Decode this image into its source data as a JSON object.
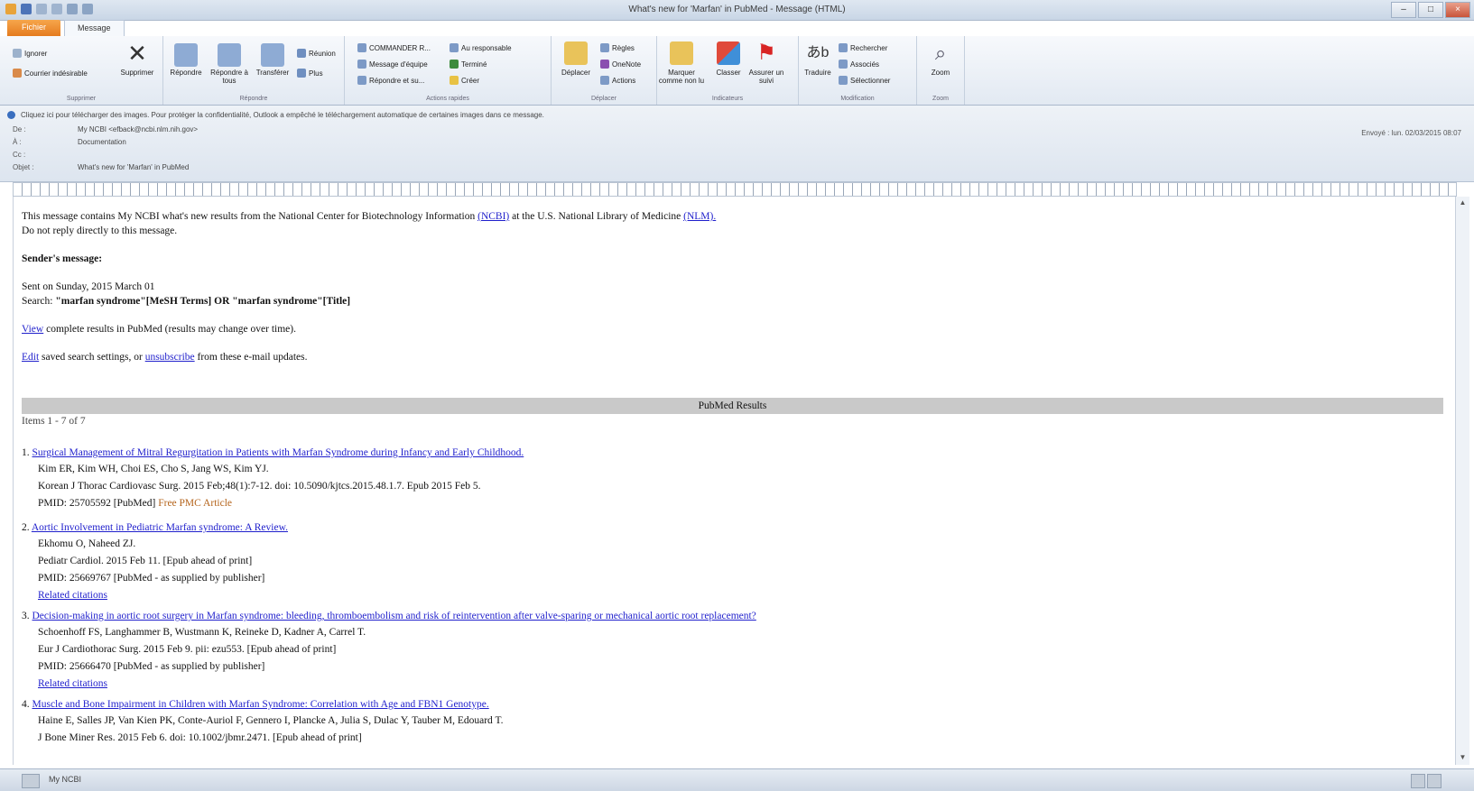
{
  "window": {
    "title": "What's new for 'Marfan' in PubMed - Message (HTML)"
  },
  "tabs": {
    "file": "Fichier",
    "message": "Message"
  },
  "ribbon": {
    "ignore": "Ignorer",
    "junk": "Courrier indésirable",
    "delete": "Supprimer",
    "reply": "Répondre",
    "reply_all": "Répondre à tous",
    "forward": "Transférer",
    "meeting": "Réunion",
    "more": "Plus",
    "qs1": "COMMANDER R...",
    "qs2": "Message d'équipe",
    "qs3": "Répondre et su...",
    "qs4": "Au responsable",
    "qs5": "Terminé",
    "qs6": "Créer",
    "move": "Déplacer",
    "rules": "Règles",
    "onenote": "OneNote",
    "actions": "Actions",
    "mark_unread": "Marquer comme non lu",
    "categorize": "Classer",
    "followup": "Assurer un suivi",
    "translate": "Traduire",
    "find": "Rechercher",
    "related": "Associés",
    "select": "Sélectionner",
    "zoom": "Zoom",
    "group_delete": "Supprimer",
    "group_respond": "Répondre",
    "group_quicksteps": "Actions rapides",
    "group_move": "Déplacer",
    "group_tags": "Indicateurs",
    "group_editing": "Modification",
    "group_zoom": "Zoom"
  },
  "header": {
    "infobar": "Cliquez ici pour télécharger des images. Pour protéger la confidentialité, Outlook a empêché le téléchargement automatique de certaines images dans ce message.",
    "from_label": "De :",
    "from_value": "My NCBI <efback@ncbi.nlm.nih.gov>",
    "to_label": "À :",
    "to_value": "Documentation",
    "cc_label": "Cc :",
    "subject_label": "Objet :",
    "subject_value": "What's new for 'Marfan' in PubMed",
    "sent_label": "Envoyé :",
    "sent_value": "lun. 02/03/2015 08:07"
  },
  "body": {
    "intro_a": "This message contains My NCBI what's new results from the National Center for Biotechnology Information",
    "ncbi": "(NCBI)",
    "intro_b": "at the U.S. National Library of Medicine",
    "nlm": "(NLM).",
    "noreply": "Do not reply directly to this message.",
    "sender_msg": "Sender's message:",
    "sent_on": "Sent on Sunday, 2015 March 01",
    "search_label": "Search:",
    "search_query": "\"marfan syndrome\"[MeSH Terms] OR \"marfan syndrome\"[Title]",
    "view_link": "View",
    "view_rest": "complete results in PubMed (results may change over time).",
    "edit_link": "Edit",
    "edit_mid": "saved search settings, or",
    "unsub_link": "unsubscribe",
    "edit_rest": "from these e-mail updates.",
    "pm_title": "PubMed Results",
    "items_count": "Items 1 - 7 of 7"
  },
  "results": [
    {
      "num": "1.",
      "title": "Surgical Management of Mitral Regurgitation in Patients with Marfan Syndrome during Infancy and Early Childhood.",
      "authors": "Kim ER, Kim WH, Choi ES, Cho S, Jang WS, Kim YJ.",
      "journal": "Korean J Thorac Cardiovasc Surg. 2015 Feb;48(1):7-12. doi: 10.5090/kjtcs.2015.48.1.7. Epub 2015 Feb 5.",
      "pmid": "PMID: 25705592 [PubMed]",
      "extra": "Free PMC Article"
    },
    {
      "num": "2.",
      "title": "Aortic Involvement in Pediatric Marfan syndrome: A Review.",
      "authors": "Ekhomu O, Naheed ZJ.",
      "journal": "Pediatr Cardiol. 2015 Feb 11. [Epub ahead of print]",
      "pmid": "PMID: 25669767 [PubMed - as supplied by publisher]",
      "extra": "Related citations"
    },
    {
      "num": "3.",
      "title": "Decision-making in aortic root surgery in Marfan syndrome: bleeding, thromboembolism and risk of reintervention after valve-sparing or mechanical aortic root replacement?",
      "authors": "Schoenhoff FS, Langhammer B, Wustmann K, Reineke D, Kadner A, Carrel T.",
      "journal": "Eur J Cardiothorac Surg. 2015 Feb 9. pii: ezu553. [Epub ahead of print]",
      "pmid": "PMID: 25666470 [PubMed - as supplied by publisher]",
      "extra": "Related citations"
    },
    {
      "num": "4.",
      "title": "Muscle and Bone Impairment in Children with Marfan Syndrome: Correlation with Age and FBN1 Genotype.",
      "authors": "Haine E, Salles JP, Van Kien PK, Conte-Auriol F, Gennero I, Plancke A, Julia S, Dulac Y, Tauber M, Edouard T.",
      "journal": "J Bone Miner Res. 2015 Feb 6. doi: 10.1002/jbmr.2471. [Epub ahead of print]"
    }
  ],
  "status": {
    "text": "My NCBI"
  },
  "colors": {
    "link": "#1f1fcc",
    "free_pmc": "#b5651d",
    "file_tab": "#e57b1f",
    "pm_bar": "#c9c9c9"
  }
}
